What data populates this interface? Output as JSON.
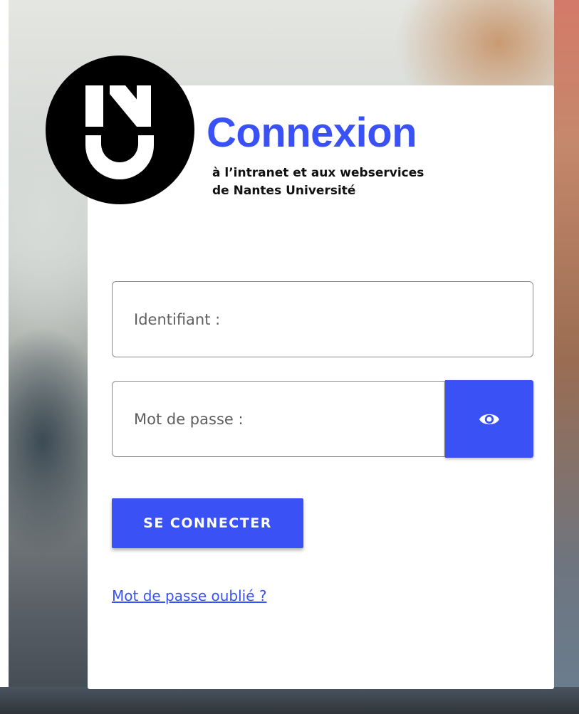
{
  "login": {
    "title": "Connexion",
    "subtitle_line1": "à l’intranet et aux webservices",
    "subtitle_line2": "de Nantes Université",
    "username_placeholder": "Identifiant :",
    "username_value": "",
    "password_placeholder": "Mot de passe :",
    "password_value": "",
    "show_password_icon": "eye-icon",
    "submit_label": "SE CONNECTER",
    "forgot_password_label": "Mot de passe oublié ?"
  },
  "logo": {
    "name": "nantes-universite-logo"
  },
  "colors": {
    "accent": "#3a52f5",
    "logo_background": "#000000",
    "card_background": "#ffffff"
  }
}
